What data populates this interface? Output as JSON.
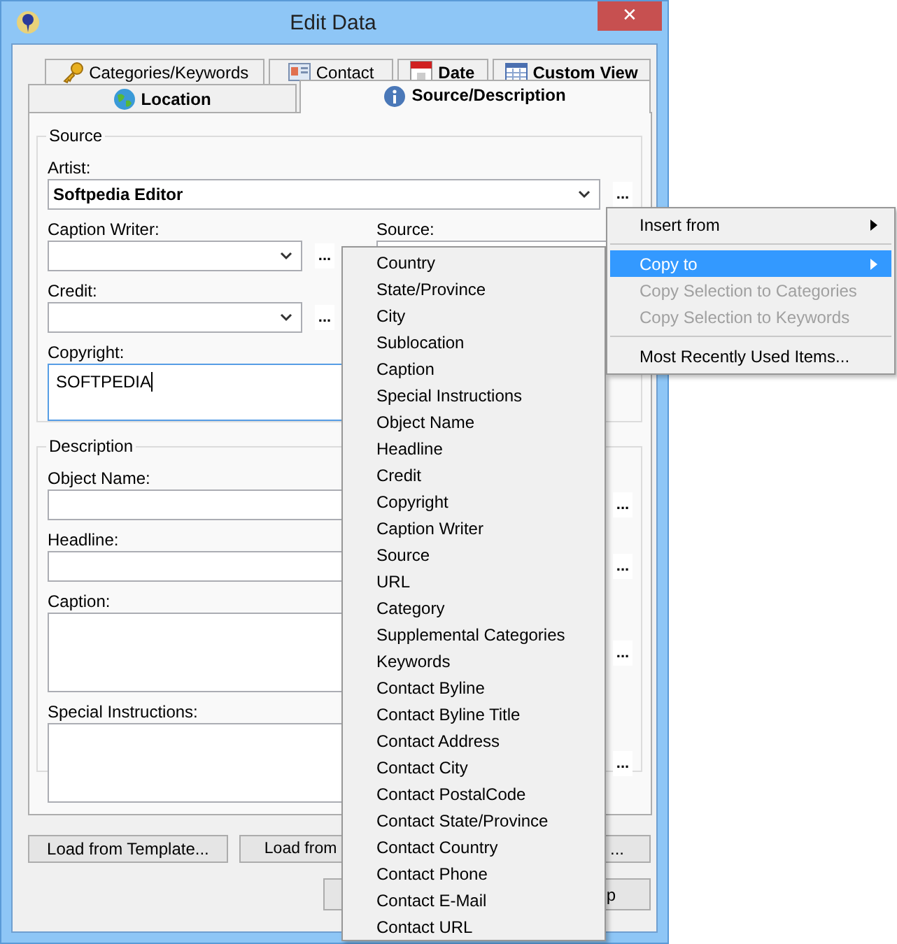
{
  "window": {
    "title": "Edit Data",
    "close": "✕"
  },
  "tabs_top": [
    {
      "label": "Categories/Keywords",
      "kind": "key",
      "bold": false,
      "selected": false
    },
    {
      "label": "Contact",
      "kind": "card",
      "bold": false,
      "selected": false
    },
    {
      "label": "Date",
      "kind": "calendar",
      "bold": true,
      "selected": false
    },
    {
      "label": "Custom View",
      "kind": "table",
      "bold": true,
      "selected": false
    }
  ],
  "tabs_bottom": [
    {
      "label": "Location",
      "kind": "globe",
      "bold": true,
      "selected": false
    },
    {
      "label": "Source/Description",
      "kind": "info",
      "bold": true,
      "selected": true
    }
  ],
  "source": {
    "title": "Source",
    "artist": {
      "label": "Artist:",
      "value": "Softpedia Editor",
      "more": "..."
    },
    "caption_writer": {
      "label": "Caption Writer:",
      "more": "..."
    },
    "source": {
      "label": "Source:"
    },
    "credit": {
      "label": "Credit:",
      "more": "..."
    },
    "copyright": {
      "label": "Copyright:",
      "value": "SOFTPEDIA"
    }
  },
  "description": {
    "title": "Description",
    "fields": [
      {
        "label": "Object Name:",
        "kind": "line",
        "more": "..."
      },
      {
        "label": "Headline:",
        "kind": "line",
        "more": "..."
      },
      {
        "label": "Caption:",
        "kind": "memo",
        "more": "..."
      },
      {
        "label": "Special Instructions:",
        "kind": "memo",
        "more": "..."
      }
    ]
  },
  "buttons": [
    {
      "label": "Load from Template..."
    },
    {
      "label": "Load from"
    },
    {
      "label": "..."
    }
  ],
  "buttons_bottom": [
    {
      "label": "p"
    }
  ],
  "dropdown_list": [
    "Country",
    "State/Province",
    "City",
    "Sublocation",
    "Caption",
    "Special Instructions",
    "Object Name",
    "Headline",
    "Credit",
    "Copyright",
    "Caption Writer",
    "Source",
    "URL",
    "Category",
    "Supplemental Categories",
    "Keywords",
    "Contact Byline",
    "Contact Byline Title",
    "Contact Address",
    "Contact City",
    "Contact PostalCode",
    "Contact State/Province",
    "Contact Country",
    "Contact Phone",
    "Contact E-Mail",
    "Contact URL"
  ],
  "context_menu": [
    {
      "kind": "item",
      "label": "Insert from",
      "submenu": true,
      "selected": false,
      "disabled": false
    },
    {
      "kind": "separator"
    },
    {
      "kind": "item",
      "label": "Copy to",
      "submenu": true,
      "selected": true,
      "disabled": false
    },
    {
      "kind": "item",
      "label": "Copy Selection to Categories",
      "submenu": false,
      "selected": false,
      "disabled": true
    },
    {
      "kind": "item",
      "label": "Copy Selection to Keywords",
      "submenu": false,
      "selected": false,
      "disabled": true
    },
    {
      "kind": "separator"
    },
    {
      "kind": "item",
      "label": "Most Recently Used Items...",
      "submenu": false,
      "selected": false,
      "disabled": false
    }
  ]
}
